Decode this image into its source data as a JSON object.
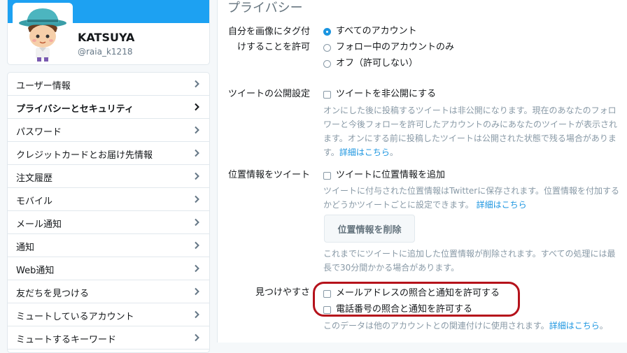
{
  "profile": {
    "display_name": "KATSUYA",
    "screen_name": "@raia_k1218"
  },
  "nav": {
    "items": [
      {
        "label": "ユーザー情報"
      },
      {
        "label": "プライバシーとセキュリティ"
      },
      {
        "label": "パスワード"
      },
      {
        "label": "クレジットカードとお届け先情報"
      },
      {
        "label": "注文履歴"
      },
      {
        "label": "モバイル"
      },
      {
        "label": "メール通知"
      },
      {
        "label": "通知"
      },
      {
        "label": "Web通知"
      },
      {
        "label": "友だちを見つける"
      },
      {
        "label": "ミュートしているアカウント"
      },
      {
        "label": "ミュートするキーワード"
      }
    ],
    "active_index": 1
  },
  "main": {
    "title": "プライバシー",
    "photo_tagging": {
      "label_line1": "自分を画像にタグ付",
      "label_line2": "けすることを許可",
      "options": [
        "すべてのアカウント",
        "フォロー中のアカウントのみ",
        "オフ（許可しない）"
      ],
      "selected_index": 0
    },
    "tweet_privacy": {
      "label": "ツイートの公開設定",
      "checkbox_label": "ツイートを非公開にする",
      "help_line1": "オンにした後に投稿するツイートは非公開になります。現在のあなたのフォロ",
      "help_line2": "ワーと今後フォローを許可したアカウントのみにあなたのツイートが表示され",
      "help_line3": "ます。オンにする前に投稿したツイートは公開された状態で残る場合がありま",
      "help_line4_prefix": "す。",
      "help_link": "詳細はこちら",
      "help_line4_suffix": "。"
    },
    "location": {
      "label": "位置情報をツイート",
      "checkbox_label": "ツイートに位置情報を追加",
      "help_line1": "ツイートに付与された位置情報はTwitterに保存されます。位置情報を付加する",
      "help_line2_prefix": "かどうかツイートごとに設定できます。",
      "help_link": "詳細はこちら",
      "delete_button": "位置情報を削除",
      "delete_help_line1": "これまでにツイートに追加した位置情報が削除されます。すべての処理には最",
      "delete_help_line2": "長で30分間かかる場合があります。"
    },
    "discoverability": {
      "label": "見つけやすさ",
      "email_checkbox": "メールアドレスの照合と通知を許可する",
      "phone_checkbox": "電話番号の照合と通知を許可する",
      "help_prefix": "このデータは他のアカウントとの関連付けに使用されます。",
      "help_link": "詳細はこちら",
      "help_suffix": "。"
    }
  },
  "colors": {
    "accent": "#1b95e0",
    "banner": "#1da1f2",
    "highlight": "#b5121b"
  }
}
